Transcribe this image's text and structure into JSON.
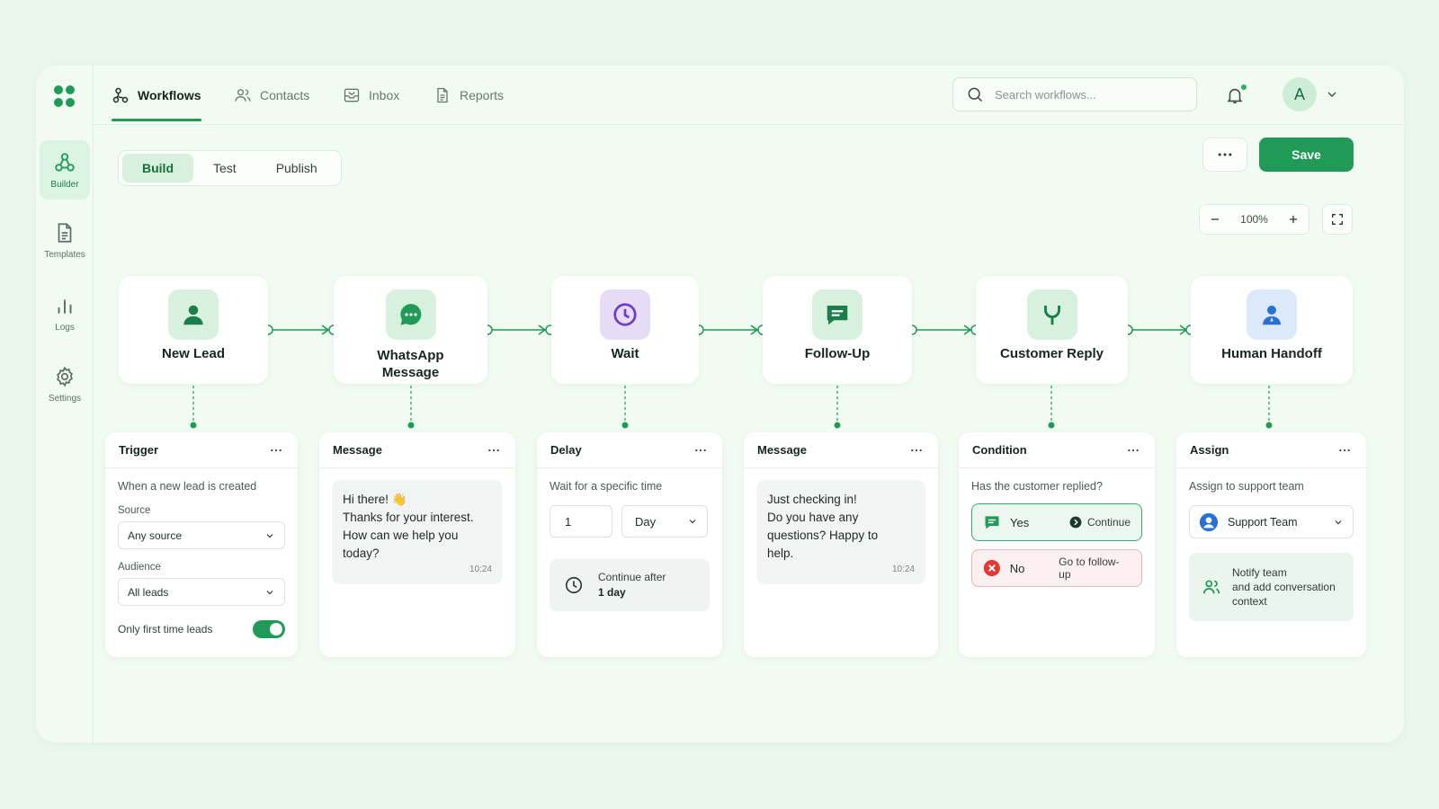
{
  "nav": {
    "tabs": [
      {
        "label": "Workflows",
        "icon": "workflow-icon",
        "active": true
      },
      {
        "label": "Contacts",
        "icon": "contacts-icon",
        "active": false
      },
      {
        "label": "Inbox",
        "icon": "inbox-icon",
        "active": false
      },
      {
        "label": "Reports",
        "icon": "reports-icon",
        "active": false
      }
    ],
    "search_placeholder": "Search workflows...",
    "avatar_initial": "A"
  },
  "sidebar": {
    "items": [
      {
        "label": "Builder",
        "icon": "builder-icon",
        "active": true
      },
      {
        "label": "Templates",
        "icon": "templates-icon",
        "active": false
      },
      {
        "label": "Logs",
        "icon": "logs-icon",
        "active": false
      },
      {
        "label": "Settings",
        "icon": "settings-icon",
        "active": false
      }
    ]
  },
  "toolbar": {
    "modes": [
      "Build",
      "Test",
      "Publish"
    ],
    "active_mode": "Build",
    "save_label": "Save",
    "zoom_level": "100%"
  },
  "colors": {
    "accent": "#1f9a57",
    "background": "#eaf8ec",
    "no_option": "#e53935"
  },
  "workflow": {
    "nodes": [
      {
        "label": "New Lead",
        "icon": "person-icon"
      },
      {
        "label": "WhatsApp Message",
        "icon": "whatsapp-icon"
      },
      {
        "label": "Wait",
        "icon": "clock-icon"
      },
      {
        "label": "Follow-Up",
        "icon": "chat-icon"
      },
      {
        "label": "Customer Reply",
        "icon": "branch-icon"
      },
      {
        "label": "Human Handoff",
        "icon": "agent-icon"
      }
    ]
  },
  "cards": {
    "trigger": {
      "title": "Trigger",
      "description": "When a new lead is created",
      "source_label": "Source",
      "source_value": "Any source",
      "audience_label": "Audience",
      "audience_value": "All leads",
      "toggle_label": "Only first time leads",
      "toggle_on": true
    },
    "message1": {
      "title": "Message",
      "lines": [
        "Hi there! 👋",
        "Thanks for your interest.",
        "How can we help you",
        "today?"
      ],
      "time": "10:24"
    },
    "delay": {
      "title": "Delay",
      "description": "Wait for a specific time",
      "amount": "1",
      "unit": "Day",
      "info_line1": "Continue after",
      "info_line2": "1 day"
    },
    "message2": {
      "title": "Message",
      "lines": [
        "Just checking in!",
        "Do you have any",
        "questions? Happy to",
        "help."
      ],
      "time": "10:24"
    },
    "condition": {
      "title": "Condition",
      "question": "Has the customer replied?",
      "yes_label": "Yes",
      "yes_action": "Continue",
      "no_label": "No",
      "no_action": "Go to follow-up"
    },
    "assign": {
      "title": "Assign",
      "description": "Assign to support team",
      "team": "Support Team",
      "notify_lines": [
        "Notify team",
        "and add conversation",
        "context"
      ]
    }
  }
}
